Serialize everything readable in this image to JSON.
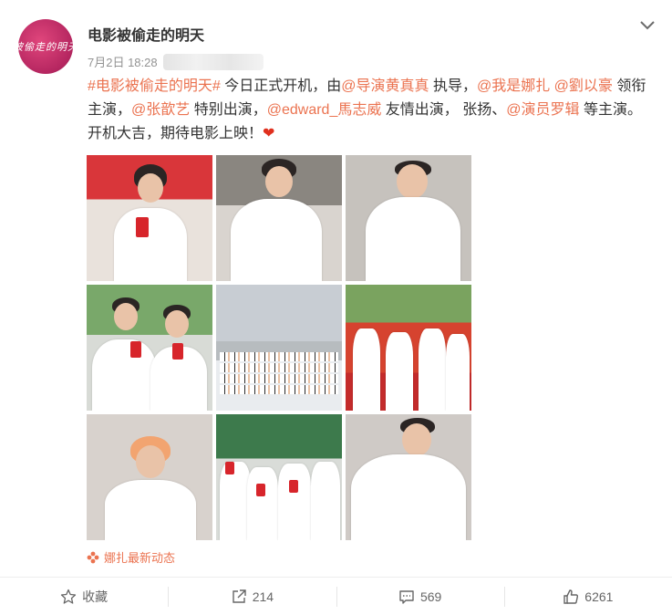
{
  "post": {
    "username": "电影被偷走的明天",
    "date": "7月2日 18:28",
    "avatar_text": "被偷走的明天",
    "text": {
      "hashtag": "#电影被偷走的明天#",
      "t1": " 今日正式开机，由",
      "m1": "@导演黄真真",
      "t2": " 执导，",
      "m2": "@我是娜扎",
      "t3": " ",
      "m3": "@劉以豪",
      "t4": " 领衔主演，",
      "m4": "@张歆艺",
      "t5": " 特别出演，",
      "m5": "@edward_馬志威",
      "t6": " 友情出演， 张扬、",
      "m6": "@演员罗辑",
      "t7": " 等主演。开机大吉，期待电影上映！",
      "heart": "❤"
    },
    "source": "娜扎最新动态"
  },
  "actions": {
    "favorite": {
      "label": "收藏",
      "icon": "star-icon"
    },
    "share": {
      "count": "214",
      "icon": "share-icon"
    },
    "comment": {
      "count": "569",
      "icon": "comment-icon"
    },
    "like": {
      "count": "6261",
      "icon": "thumbs-up-icon"
    }
  },
  "colors": {
    "link": "#eb7350",
    "text": "#333333",
    "meta": "#939393"
  }
}
